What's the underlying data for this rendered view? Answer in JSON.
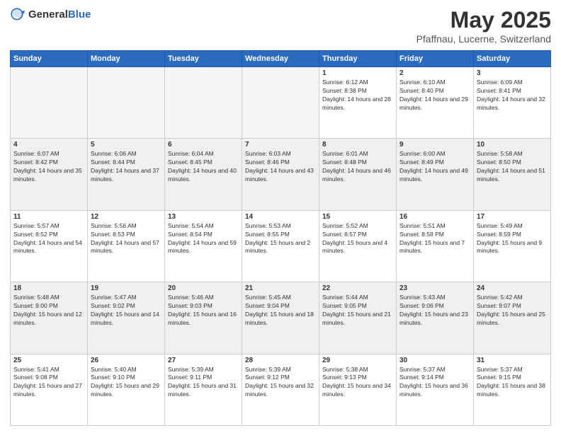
{
  "header": {
    "logo_general": "General",
    "logo_blue": "Blue",
    "title": "May 2025",
    "subtitle": "Pfaffnau, Lucerne, Switzerland"
  },
  "days_of_week": [
    "Sunday",
    "Monday",
    "Tuesday",
    "Wednesday",
    "Thursday",
    "Friday",
    "Saturday"
  ],
  "weeks": [
    [
      {
        "day": "",
        "info": ""
      },
      {
        "day": "",
        "info": ""
      },
      {
        "day": "",
        "info": ""
      },
      {
        "day": "",
        "info": ""
      },
      {
        "day": "1",
        "info": "Sunrise: 6:12 AM\nSunset: 8:38 PM\nDaylight: 14 hours and 26 minutes."
      },
      {
        "day": "2",
        "info": "Sunrise: 6:10 AM\nSunset: 8:40 PM\nDaylight: 14 hours and 29 minutes."
      },
      {
        "day": "3",
        "info": "Sunrise: 6:09 AM\nSunset: 8:41 PM\nDaylight: 14 hours and 32 minutes."
      }
    ],
    [
      {
        "day": "4",
        "info": "Sunrise: 6:07 AM\nSunset: 8:42 PM\nDaylight: 14 hours and 35 minutes."
      },
      {
        "day": "5",
        "info": "Sunrise: 6:06 AM\nSunset: 8:44 PM\nDaylight: 14 hours and 37 minutes."
      },
      {
        "day": "6",
        "info": "Sunrise: 6:04 AM\nSunset: 8:45 PM\nDaylight: 14 hours and 40 minutes."
      },
      {
        "day": "7",
        "info": "Sunrise: 6:03 AM\nSunset: 8:46 PM\nDaylight: 14 hours and 43 minutes."
      },
      {
        "day": "8",
        "info": "Sunrise: 6:01 AM\nSunset: 8:48 PM\nDaylight: 14 hours and 46 minutes."
      },
      {
        "day": "9",
        "info": "Sunrise: 6:00 AM\nSunset: 8:49 PM\nDaylight: 14 hours and 49 minutes."
      },
      {
        "day": "10",
        "info": "Sunrise: 5:58 AM\nSunset: 8:50 PM\nDaylight: 14 hours and 51 minutes."
      }
    ],
    [
      {
        "day": "11",
        "info": "Sunrise: 5:57 AM\nSunset: 8:52 PM\nDaylight: 14 hours and 54 minutes."
      },
      {
        "day": "12",
        "info": "Sunrise: 5:56 AM\nSunset: 8:53 PM\nDaylight: 14 hours and 57 minutes."
      },
      {
        "day": "13",
        "info": "Sunrise: 5:54 AM\nSunset: 8:54 PM\nDaylight: 14 hours and 59 minutes."
      },
      {
        "day": "14",
        "info": "Sunrise: 5:53 AM\nSunset: 8:55 PM\nDaylight: 15 hours and 2 minutes."
      },
      {
        "day": "15",
        "info": "Sunrise: 5:52 AM\nSunset: 8:57 PM\nDaylight: 15 hours and 4 minutes."
      },
      {
        "day": "16",
        "info": "Sunrise: 5:51 AM\nSunset: 8:58 PM\nDaylight: 15 hours and 7 minutes."
      },
      {
        "day": "17",
        "info": "Sunrise: 5:49 AM\nSunset: 8:59 PM\nDaylight: 15 hours and 9 minutes."
      }
    ],
    [
      {
        "day": "18",
        "info": "Sunrise: 5:48 AM\nSunset: 9:00 PM\nDaylight: 15 hours and 12 minutes."
      },
      {
        "day": "19",
        "info": "Sunrise: 5:47 AM\nSunset: 9:02 PM\nDaylight: 15 hours and 14 minutes."
      },
      {
        "day": "20",
        "info": "Sunrise: 5:46 AM\nSunset: 9:03 PM\nDaylight: 15 hours and 16 minutes."
      },
      {
        "day": "21",
        "info": "Sunrise: 5:45 AM\nSunset: 9:04 PM\nDaylight: 15 hours and 18 minutes."
      },
      {
        "day": "22",
        "info": "Sunrise: 5:44 AM\nSunset: 9:05 PM\nDaylight: 15 hours and 21 minutes."
      },
      {
        "day": "23",
        "info": "Sunrise: 5:43 AM\nSunset: 9:06 PM\nDaylight: 15 hours and 23 minutes."
      },
      {
        "day": "24",
        "info": "Sunrise: 5:42 AM\nSunset: 9:07 PM\nDaylight: 15 hours and 25 minutes."
      }
    ],
    [
      {
        "day": "25",
        "info": "Sunrise: 5:41 AM\nSunset: 9:08 PM\nDaylight: 15 hours and 27 minutes."
      },
      {
        "day": "26",
        "info": "Sunrise: 5:40 AM\nSunset: 9:10 PM\nDaylight: 15 hours and 29 minutes."
      },
      {
        "day": "27",
        "info": "Sunrise: 5:39 AM\nSunset: 9:11 PM\nDaylight: 15 hours and 31 minutes."
      },
      {
        "day": "28",
        "info": "Sunrise: 5:39 AM\nSunset: 9:12 PM\nDaylight: 15 hours and 32 minutes."
      },
      {
        "day": "29",
        "info": "Sunrise: 5:38 AM\nSunset: 9:13 PM\nDaylight: 15 hours and 34 minutes."
      },
      {
        "day": "30",
        "info": "Sunrise: 5:37 AM\nSunset: 9:14 PM\nDaylight: 15 hours and 36 minutes."
      },
      {
        "day": "31",
        "info": "Sunrise: 5:37 AM\nSunset: 9:15 PM\nDaylight: 15 hours and 38 minutes."
      }
    ]
  ]
}
